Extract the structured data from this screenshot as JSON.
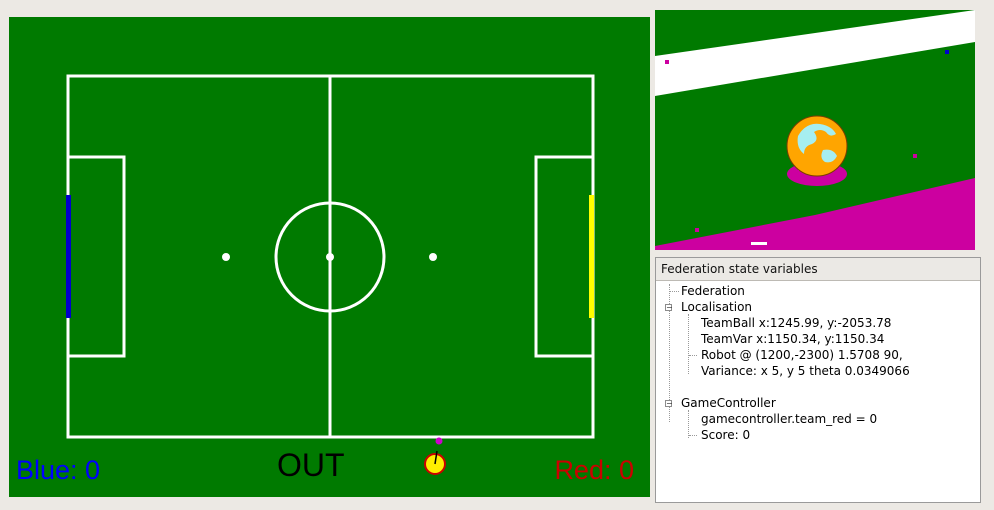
{
  "field": {
    "score_blue": "Blue: 0",
    "score_red": "Red: 0",
    "game_state": "OUT",
    "colors": {
      "grass": "#007a00",
      "lines": "#ffffff",
      "blue_goal": "#0000cc",
      "yellow_goal": "#ffff00",
      "blue_text": "#0000ff",
      "red_text": "#cc0000",
      "robot": "#ffee00",
      "robot_marker": "#cc00cc"
    },
    "robot_icon": "robot-marker-icon"
  },
  "camera": {
    "colors": {
      "green": "#007a00",
      "white_line": "#ffffff",
      "ball": "#ffa500",
      "ball_highlight": "#a6eef0",
      "magenta": "#cc00a0"
    }
  },
  "state_panel": {
    "title": "Federation state variables",
    "tree": [
      {
        "label": "Federation",
        "level": 0,
        "expandable": false
      },
      {
        "label": "Localisation",
        "level": 0,
        "expandable": true,
        "expanded": true
      },
      {
        "label": "TeamBall x:1245.99, y:-2053.78",
        "level": 1
      },
      {
        "label": "TeamVar x:1150.34, y:1150.34",
        "level": 1
      },
      {
        "label": "Robot @ (1200,-2300) 1.5708 90,",
        "level": 1
      },
      {
        "label": "Variance: x 5, y 5 theta 0.0349066",
        "level": 1
      },
      {
        "label": "",
        "level": 0
      },
      {
        "label": "GameController",
        "level": 0,
        "expandable": true,
        "expanded": true
      },
      {
        "label": "gamecontroller.team_red = 0",
        "level": 1
      },
      {
        "label": "Score: 0",
        "level": 1
      }
    ]
  }
}
